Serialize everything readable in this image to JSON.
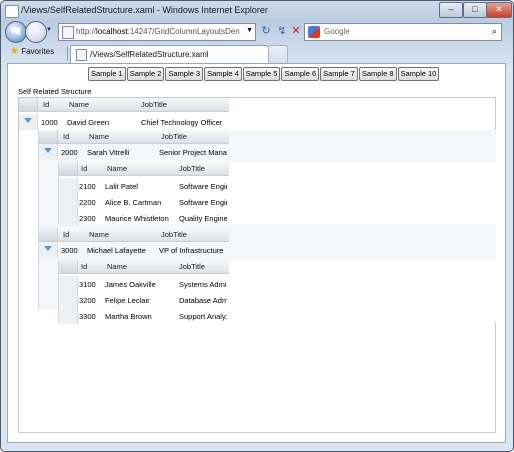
{
  "window": {
    "title": "/Views/SelfRelatedStructure.xaml - Windows Internet Explorer",
    "minimize_glyph": "–",
    "maximize_glyph": "□",
    "close_glyph": "✕"
  },
  "nav": {
    "back_glyph": "◀",
    "forward_glyph": "▶",
    "history_glyph": "▼",
    "address_prefix": "http://",
    "address_host": "localhost",
    "address_rest": ":14247/GridColumnLayoutsDen",
    "address_dropdown_glyph": "▼",
    "refresh_glyph": "↻",
    "compat_glyph": "↯",
    "stop_glyph": "✕",
    "search_placeholder": "Google",
    "search_glyph": "⌕"
  },
  "tabs": {
    "favorites_label": "Favorites",
    "active_tab_label": "/Views/SelfRelatedStructure.xaml"
  },
  "samples": [
    "Sample 1",
    "Sample 2",
    "Sample 3",
    "Sample 4",
    "Sample 5",
    "Sample 6",
    "Sample 7",
    "Sample 8",
    "Sample 10"
  ],
  "page": {
    "section_title": "Self Related Structure"
  },
  "grid": {
    "columns": [
      "Id",
      "Name",
      "JobTitle"
    ],
    "root": {
      "id": "1000",
      "name": "David Green",
      "title": "Chief Technology Officer",
      "children": [
        {
          "id": "2000",
          "name": "Sarah Vitrelli",
          "title": "Senior Project Mana",
          "children": [
            {
              "id": "2100",
              "name": "Lalit Patel",
              "title": "Software Engir"
            },
            {
              "id": "2200",
              "name": "Alice B. Cartman",
              "title": "Software Engir"
            },
            {
              "id": "2300",
              "name": "Maurice Whistleton",
              "title": "Quality Engine"
            }
          ]
        },
        {
          "id": "3000",
          "name": "Michael Lafayette",
          "title": "VP of Infrastructure",
          "children": [
            {
              "id": "3100",
              "name": "James Oakville",
              "title": "Systems Admi"
            },
            {
              "id": "3200",
              "name": "Felipe Leclair",
              "title": "Database Adm"
            },
            {
              "id": "3300",
              "name": "Martha Brown",
              "title": "Support Analy:"
            }
          ]
        }
      ]
    }
  },
  "colors": {
    "expand_arrow": "#4a9ed4",
    "frame_blue": "#b9cbe0"
  }
}
